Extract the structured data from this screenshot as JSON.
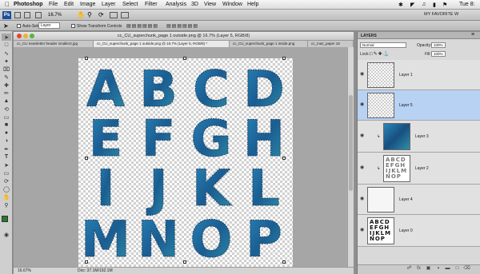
{
  "menubar": {
    "app_name": "Photoshop",
    "items": [
      "File",
      "Edit",
      "Image",
      "Layer",
      "Select",
      "Filter",
      "Analysis",
      "3D",
      "View",
      "Window",
      "Help"
    ],
    "clock": "Tue 8:",
    "workspace_name": "MY FAVORITE W"
  },
  "appbar": {
    "zoom": "16.7%"
  },
  "optbar": {
    "auto_select_label": "Auto-Select:",
    "auto_select_value": "Layer",
    "transform_label": "Show Transform Controls"
  },
  "document": {
    "title": "cc_CU_superchunk_page 1 outside.png @ 16.7% (Layer 5, RGB/8)",
    "tabs": [
      "cc_CU newsletter header smaller2.jpg",
      "cc_CU_superchunk_page 1 outside.png @ 16.7% (Layer 5, RGB/8) *",
      "cc_CU_superchunk_page 1 inside.png",
      "cc_mas_paper 18"
    ],
    "letters": [
      "A",
      "B",
      "C",
      "D",
      "E",
      "F",
      "G",
      "H",
      "I",
      "J",
      "K",
      "L",
      "M",
      "N",
      "O",
      "P"
    ],
    "letter_color": "#1f6a9a"
  },
  "status": {
    "zoom": "16.67%",
    "doc_size": "Doc: 37.1M/192.1M"
  },
  "layers_panel": {
    "tab_label": "LAYERS",
    "blend_mode": "Normal",
    "opacity_label": "Opacity:",
    "opacity_value": "100%",
    "lock_label": "Lock:",
    "fill_label": "Fill:",
    "fill_value": "100%",
    "layers": [
      {
        "name": "Layer 1",
        "selected": false,
        "linked": false,
        "thumb": "empty"
      },
      {
        "name": "Layer 5",
        "selected": true,
        "linked": false,
        "thumb": "empty"
      },
      {
        "name": "Layer 3",
        "selected": false,
        "linked": true,
        "thumb": "blue"
      },
      {
        "name": "Layer 2",
        "selected": false,
        "linked": true,
        "thumb": "letters"
      },
      {
        "name": "Layer 4",
        "selected": false,
        "linked": false,
        "thumb": "white"
      },
      {
        "name": "Layer 0",
        "selected": false,
        "linked": false,
        "thumb": "black-letters"
      }
    ]
  }
}
